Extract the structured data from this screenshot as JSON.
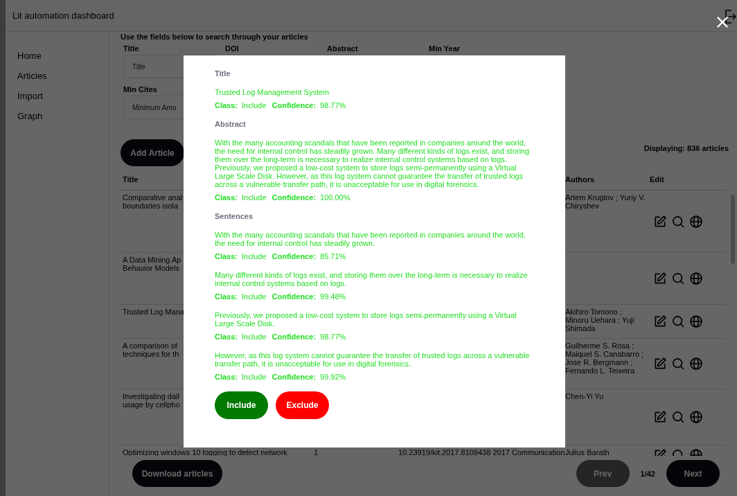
{
  "app": {
    "title": "Lit automation dashboard"
  },
  "sidebar": {
    "items": [
      {
        "label": "Home"
      },
      {
        "label": "Articles"
      },
      {
        "label": "Import"
      },
      {
        "label": "Graph"
      }
    ]
  },
  "search": {
    "hint": "Use the fields below to search through your articles",
    "fields": [
      {
        "label": "Title",
        "placeholder": "Title"
      },
      {
        "label": "DOI"
      },
      {
        "label": "Abstract"
      },
      {
        "label": "Min Year"
      },
      {
        "label": "Min Cites",
        "placeholder": "Minimum Amo"
      }
    ]
  },
  "add_button": "Add Article",
  "count": "Displaying: 836 articles",
  "table": {
    "columns": [
      {
        "label": "Title"
      },
      {},
      {},
      {
        "label": "Authors"
      },
      {
        "label": "Edit"
      }
    ],
    "rows": [
      {
        "title": "Comparative anal\nboundaries isola",
        "authors": "Artem Kruglov ; Yuriy V. Chiryshev"
      },
      {
        "title": "A Data Mining Ap\nBehavior Models"
      },
      {
        "title": "Trusted Log Mana",
        "authors": "Akihiro Tomono ; Minoru Uehara ; Yuji Shimada"
      },
      {
        "title": "A comparison of\ntechniques for th",
        "authors": "Guilherme S. Rosa ; Maiquel S. Canabarro ; Jose R. Bergmann ; Fernando L. Teixeira"
      },
      {
        "title": "Investigating dail\nusage by cellpho",
        "authors": "Chen-Yi Yu"
      },
      {
        "title": "Optimizing windows 10 logging to detect network",
        "column_2": "1",
        "column_3": "10.23919/kit.2017.8109438 2017 Communication",
        "authors": "Julius Barath"
      }
    ]
  },
  "download_button": "Download articles",
  "pagination": {
    "prev": {
      "label": "Prev",
      "disabled": true
    },
    "page": "1/42",
    "next": {
      "label": "Next",
      "disabled": false
    }
  },
  "modal": {
    "sections": [
      {
        "heading": "Title",
        "items": [
          {
            "text": "Trusted Log Management System",
            "class_label": "Class:",
            "class": "Include",
            "confidence_label": "Confidence:",
            "confidence": "98.77%"
          }
        ]
      },
      {
        "heading": "Abstract",
        "items": [
          {
            "text": "With the many accounting scandals that have been reported in companies around the world, the need for internal control has steadily grown. Many different kinds of logs exist, and storing them over the long-term is necessary to realize internal control systems based on logs. Previously, we proposed a low-cost system to store logs semi-permanently using a Virtual Large Scale Disk. However, as this log system cannot guarantee the transfer of trusted logs across a vulnerable transfer path, it is unacceptable for use in digital forensics.",
            "class_label": "Class:",
            "class": "Include",
            "confidence_label": "Confidence:",
            "confidence": "100.00%"
          }
        ]
      },
      {
        "heading": "Sentences",
        "items": [
          {
            "text": "With the many accounting scandals that have been reported in companies around the world, the need for internal control has steadily grown.",
            "class_label": "Class:",
            "class": "Include",
            "confidence_label": "Confidence:",
            "confidence": "85.71%"
          },
          {
            "text": "Many different kinds of logs exist, and storing them over the long-term is necessary to realize internal control systems based on logs.",
            "class_label": "Class:",
            "class": "Include",
            "confidence_label": "Confidence:",
            "confidence": "99.48%"
          },
          {
            "text": "Previously, we proposed a low-cost system to store logs semi-permanently using a Virtual Large Scale Disk.",
            "class_label": "Class:",
            "class": "Include",
            "confidence_label": "Confidence:",
            "confidence": "98.77%"
          },
          {
            "text": "However, as this log system cannot guarantee the transfer of trusted logs across a vulnerable transfer path, it is unacceptable for use in digital forensics.",
            "class_label": "Class:",
            "class": "Include",
            "confidence_label": "Confidence:",
            "confidence": "99.92%"
          }
        ]
      }
    ],
    "buttons": [
      {
        "label": "Include",
        "kind": "include"
      },
      {
        "label": "Exclude",
        "kind": "exclude"
      }
    ]
  }
}
